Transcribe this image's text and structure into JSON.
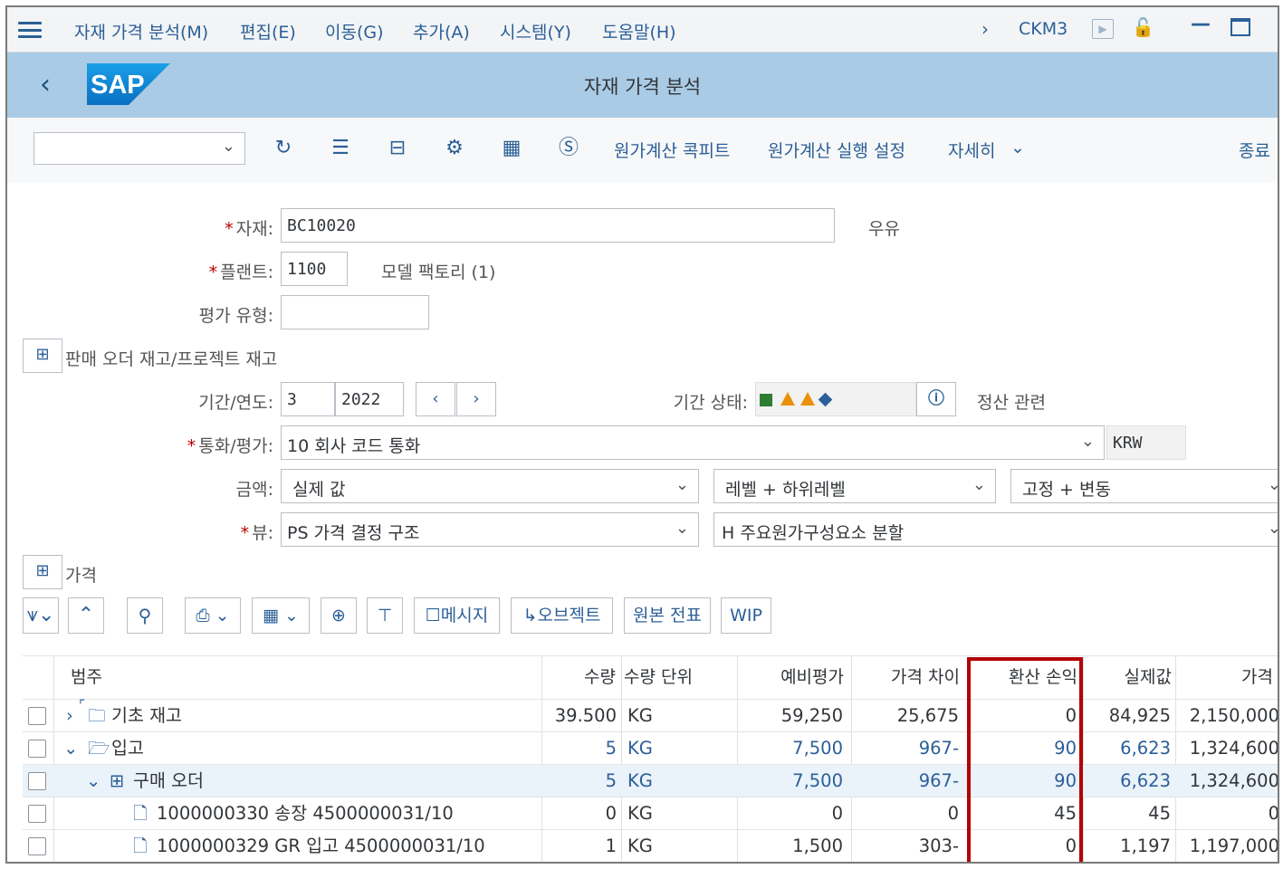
{
  "menubar": {
    "items": [
      "자재 가격 분석(M)",
      "편집(E)",
      "이동(G)",
      "추가(A)",
      "시스템(Y)",
      "도움말(H)"
    ],
    "tcode": "CKM3"
  },
  "header": {
    "logo_text": "SAP",
    "title": "자재 가격 분석"
  },
  "toolbar": {
    "dropdown_value": "",
    "buttons": [
      "원가계산 콕피트",
      "원가계산 실행 설정",
      "자세히"
    ],
    "exit_label": "종료"
  },
  "form": {
    "material_label": "자재:",
    "material_value": "BC10020",
    "material_desc": "우유",
    "plant_label": "플랜트:",
    "plant_value": "1100",
    "plant_desc": "모델 팩토리 (1)",
    "valuation_label": "평가 유형:",
    "valuation_value": "",
    "sales_order_label": "판매 오더 재고/프로젝트 재고",
    "period_label": "기간/연도:",
    "period_value": "3",
    "year_value": "2022",
    "period_status_label": "기간 상태:",
    "settlement_label": "정산 관련",
    "currency_label": "통화/평가:",
    "currency_value": "10 회사 코드 통화",
    "currency_code": "KRW",
    "amount_label": "금액:",
    "amount_value": "실제 값",
    "level_value": "레벨 + 하위레벨",
    "fixvar_value": "고정 + 변동",
    "view_label": "뷰:",
    "view_value": "PS 가격 결정 구조",
    "split_value": "H 주요원가구성요소 분할",
    "price_section_label": "가격"
  },
  "grid_toolbar": {
    "message_btn": "메시지",
    "object_btn": "오브젝트",
    "original_doc_btn": "원본 전표",
    "wip_btn": "WIP"
  },
  "table": {
    "columns": [
      "범주",
      "수량",
      "수량 단위",
      "예비평가",
      "가격 차이",
      "환산 손익",
      "실제값",
      "가격"
    ],
    "rows": [
      {
        "label": "기초 재고",
        "qty": "39.500",
        "unit": "KG",
        "prelim": "59,250",
        "pricediff": "25,675",
        "exch": "0",
        "actual": "84,925",
        "price": "2,150,000"
      },
      {
        "label": "입고",
        "qty": "5",
        "unit": "KG",
        "prelim": "7,500",
        "pricediff": "967-",
        "exch": "90",
        "actual": "6,623",
        "price": "1,324,600"
      },
      {
        "label": "구매 오더",
        "qty": "5",
        "unit": "KG",
        "prelim": "7,500",
        "pricediff": "967-",
        "exch": "90",
        "actual": "6,623",
        "price": "1,324,600"
      },
      {
        "label": "1000000330 송장 4500000031/10",
        "qty": "0",
        "unit": "KG",
        "prelim": "0",
        "pricediff": "0",
        "exch": "45",
        "actual": "45",
        "price": "0"
      },
      {
        "label": "1000000329 GR 입고 4500000031/10",
        "qty": "1",
        "unit": "KG",
        "prelim": "1,500",
        "pricediff": "303-",
        "exch": "0",
        "actual": "1,197",
        "price": "1,197,000"
      }
    ]
  },
  "colors": {
    "accent": "#2b5f97",
    "header_bg": "#a9cbe6",
    "highlight": "#b40000",
    "status_green": "#2e7d32",
    "status_orange": "#e8920a",
    "status_blue": "#2b5f97"
  }
}
